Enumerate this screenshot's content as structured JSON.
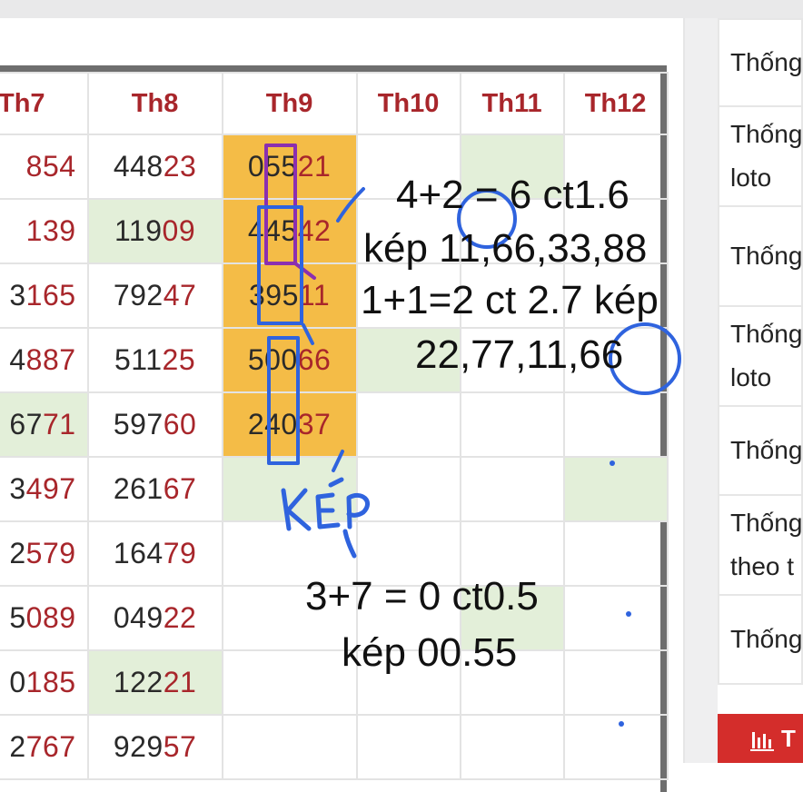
{
  "table": {
    "headers": [
      "Th7",
      "Th8",
      "Th9",
      "Th10",
      "Th11",
      "Th12"
    ],
    "rows": [
      [
        {
          "pre": "",
          "digits": "854"
        },
        {
          "pre": "448",
          "digits": "23"
        },
        {
          "pre": "055",
          "digits": "21"
        },
        {
          "pre": "",
          "digits": ""
        },
        {
          "pre": "",
          "digits": ""
        },
        {
          "pre": "",
          "digits": ""
        }
      ],
      [
        {
          "pre": "",
          "digits": "139"
        },
        {
          "pre": "119",
          "digits": "09"
        },
        {
          "pre": "445",
          "digits": "42"
        },
        {
          "pre": "",
          "digits": ""
        },
        {
          "pre": "",
          "digits": ""
        },
        {
          "pre": "",
          "digits": ""
        }
      ],
      [
        {
          "pre": "3",
          "digits": "165"
        },
        {
          "pre": "792",
          "digits": "47"
        },
        {
          "pre": "395",
          "digits": "11"
        },
        {
          "pre": "",
          "digits": ""
        },
        {
          "pre": "",
          "digits": ""
        },
        {
          "pre": "",
          "digits": ""
        }
      ],
      [
        {
          "pre": "4",
          "digits": "887"
        },
        {
          "pre": "511",
          "digits": "25"
        },
        {
          "pre": "500",
          "digits": "66"
        },
        {
          "pre": "",
          "digits": ""
        },
        {
          "pre": "",
          "digits": ""
        },
        {
          "pre": "",
          "digits": ""
        }
      ],
      [
        {
          "pre": "67",
          "digits": "71"
        },
        {
          "pre": "597",
          "digits": "60"
        },
        {
          "pre": "240",
          "digits": "37"
        },
        {
          "pre": "",
          "digits": ""
        },
        {
          "pre": "",
          "digits": ""
        },
        {
          "pre": "",
          "digits": ""
        }
      ],
      [
        {
          "pre": "3",
          "digits": "497"
        },
        {
          "pre": "261",
          "digits": "67"
        },
        {
          "pre": "",
          "digits": ""
        },
        {
          "pre": "",
          "digits": ""
        },
        {
          "pre": "",
          "digits": ""
        },
        {
          "pre": "",
          "digits": ""
        }
      ],
      [
        {
          "pre": "2",
          "digits": "579"
        },
        {
          "pre": "164",
          "digits": "79"
        },
        {
          "pre": "",
          "digits": ""
        },
        {
          "pre": "",
          "digits": ""
        },
        {
          "pre": "",
          "digits": ""
        },
        {
          "pre": "",
          "digits": ""
        }
      ],
      [
        {
          "pre": "5",
          "digits": "089"
        },
        {
          "pre": "049",
          "digits": "22"
        },
        {
          "pre": "",
          "digits": ""
        },
        {
          "pre": "",
          "digits": ""
        },
        {
          "pre": "",
          "digits": ""
        },
        {
          "pre": "",
          "digits": ""
        }
      ],
      [
        {
          "pre": "0",
          "digits": "185"
        },
        {
          "pre": "122",
          "digits": "21"
        },
        {
          "pre": "",
          "digits": ""
        },
        {
          "pre": "",
          "digits": ""
        },
        {
          "pre": "",
          "digits": ""
        },
        {
          "pre": "",
          "digits": ""
        }
      ],
      [
        {
          "pre": "2",
          "digits": "767"
        },
        {
          "pre": "929",
          "digits": "57"
        },
        {
          "pre": "",
          "digits": ""
        },
        {
          "pre": "",
          "digits": ""
        },
        {
          "pre": "",
          "digits": ""
        },
        {
          "pre": "",
          "digits": ""
        }
      ]
    ],
    "highlights": [
      [
        "",
        "",
        "orange",
        "",
        "green",
        ""
      ],
      [
        "",
        "green",
        "orange",
        "",
        "",
        ""
      ],
      [
        "",
        "",
        "orange",
        "",
        "",
        ""
      ],
      [
        "",
        "",
        "orange",
        "green",
        "",
        ""
      ],
      [
        "green",
        "",
        "orange",
        "",
        "",
        ""
      ],
      [
        "",
        "",
        "green",
        "",
        "",
        "green"
      ],
      [
        "",
        "",
        "",
        "",
        "",
        ""
      ],
      [
        "",
        "",
        "",
        "",
        "green",
        ""
      ],
      [
        "",
        "green",
        "",
        "",
        "",
        ""
      ],
      [
        "",
        "",
        "",
        "",
        "",
        ""
      ]
    ]
  },
  "sidebar": {
    "items": [
      {
        "lines": [
          "Thống"
        ]
      },
      {
        "lines": [
          "Thống",
          "loto"
        ]
      },
      {
        "lines": [
          "Thống"
        ]
      },
      {
        "lines": [
          "Thống",
          "loto"
        ]
      },
      {
        "lines": [
          "Thống"
        ]
      },
      {
        "lines": [
          "Thống",
          "theo t"
        ]
      },
      {
        "lines": [
          "Thống"
        ]
      }
    ],
    "button_label": "T"
  },
  "annotations": {
    "note1": "4+2 = 6 ct1.6",
    "note2": "kép 11,66,33,88",
    "note3": "1+1=2 ct 2.7 kép",
    "note4": "22,77,11,66",
    "note5": "KÉP",
    "note6": "3+7 = 0 ct0.5",
    "note7": "kép 00.55"
  },
  "colors": {
    "header_red": "#a8262b",
    "highlight_orange": "#f4bc47",
    "highlight_green": "#e3efd9",
    "pen_blue": "#2f63de",
    "pen_purple": "#8b2fb0",
    "button_red": "#d42d2b"
  }
}
